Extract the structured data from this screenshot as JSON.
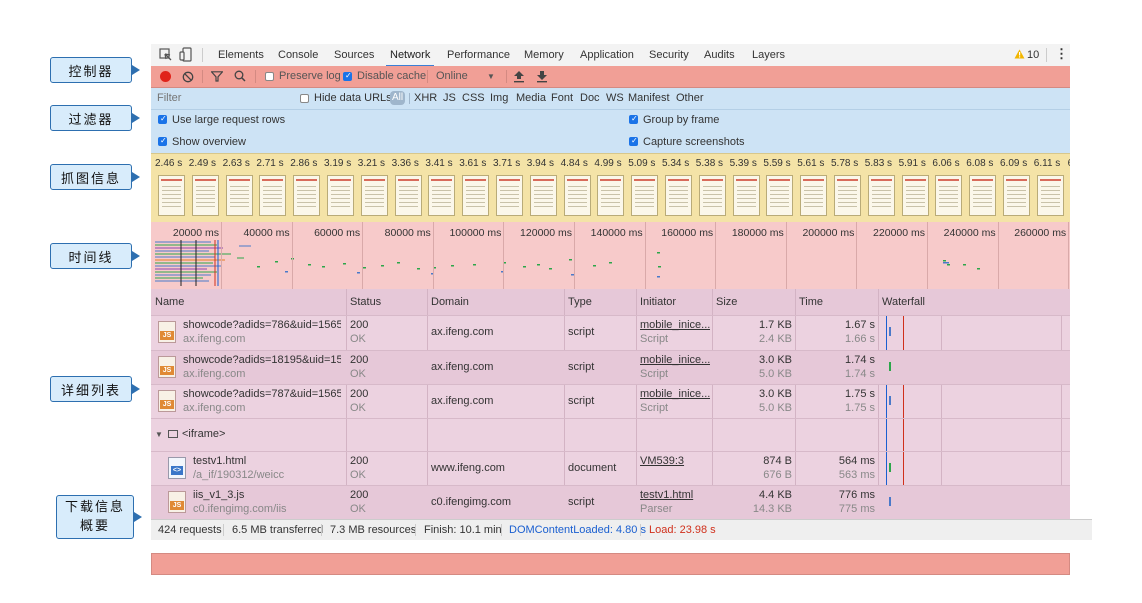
{
  "callouts": {
    "control": "控制器",
    "filter": "过滤器",
    "screenshots": "抓图信息",
    "timeline": "时间线",
    "detail": "详细列表",
    "summary_line1": "下载信息",
    "summary_line2": "概要"
  },
  "tabs": [
    "Elements",
    "Console",
    "Sources",
    "Network",
    "Performance",
    "Memory",
    "Application",
    "Security",
    "Audits",
    "Layers"
  ],
  "active_tab": "Network",
  "warnings": "10",
  "controls": {
    "preserve_log": "Preserve log",
    "disable_cache": "Disable cache",
    "throttle": "Online"
  },
  "filter": {
    "placeholder": "Filter",
    "hide_data_urls": "Hide data URLs",
    "types": [
      "All",
      "XHR",
      "JS",
      "CSS",
      "Img",
      "Media",
      "Font",
      "Doc",
      "WS",
      "Manifest",
      "Other"
    ],
    "use_large_rows": "Use large request rows",
    "group_by_frame": "Group by frame",
    "show_overview": "Show overview",
    "capture_screenshots": "Capture screenshots"
  },
  "screenshot_times": [
    "2.46 s",
    "2.49 s",
    "2.63 s",
    "2.71 s",
    "2.86 s",
    "3.19 s",
    "3.21 s",
    "3.36 s",
    "3.41 s",
    "3.61 s",
    "3.71 s",
    "3.94 s",
    "4.84 s",
    "4.99 s",
    "5.09 s",
    "5.34 s",
    "5.38 s",
    "5.39 s",
    "5.59 s",
    "5.61 s",
    "5.78 s",
    "5.83 s",
    "5.91 s",
    "6.06 s",
    "6.08 s",
    "6.09 s",
    "6.11 s",
    "6."
  ],
  "timeline_ticks": [
    "20000 ms",
    "40000 ms",
    "60000 ms",
    "80000 ms",
    "100000 ms",
    "120000 ms",
    "140000 ms",
    "160000 ms",
    "180000 ms",
    "200000 ms",
    "220000 ms",
    "240000 ms",
    "260000 ms"
  ],
  "columns": [
    "Name",
    "Status",
    "Domain",
    "Type",
    "Initiator",
    "Size",
    "Time",
    "Waterfall"
  ],
  "rows": [
    {
      "name": "showcode?adids=786&uid=1565...",
      "host": "ax.ifeng.com",
      "status": "200",
      "status_text": "OK",
      "domain": "ax.ifeng.com",
      "type": "script",
      "initiator": "mobile_inice...",
      "initiator_type": "Script",
      "size": "1.7 KB",
      "size2": "2.4 KB",
      "time": "1.67 s",
      "time2": "1.66 s"
    },
    {
      "name": "showcode?adids=18195&uid=15...",
      "host": "ax.ifeng.com",
      "status": "200",
      "status_text": "OK",
      "domain": "ax.ifeng.com",
      "type": "script",
      "initiator": "mobile_inice...",
      "initiator_type": "Script",
      "size": "3.0 KB",
      "size2": "5.0 KB",
      "time": "1.74 s",
      "time2": "1.74 s"
    },
    {
      "name": "showcode?adids=787&uid=1565...",
      "host": "ax.ifeng.com",
      "status": "200",
      "status_text": "OK",
      "domain": "ax.ifeng.com",
      "type": "script",
      "initiator": "mobile_inice...",
      "initiator_type": "Script",
      "size": "3.0 KB",
      "size2": "5.0 KB",
      "time": "1.75 s",
      "time2": "1.75 s"
    }
  ],
  "group_label": "<iframe>",
  "group_rows": [
    {
      "name": "testv1.html",
      "host": "/a_if/190312/weicc",
      "status": "200",
      "status_text": "OK",
      "domain": "www.ifeng.com",
      "type": "document",
      "initiator": "VM539:3",
      "initiator_type": "",
      "size": "874 B",
      "size2": "676 B",
      "time": "564 ms",
      "time2": "563 ms"
    },
    {
      "name": "iis_v1_3.js",
      "host": "c0.ifengimg.com/iis",
      "status": "200",
      "status_text": "OK",
      "domain": "c0.ifengimg.com",
      "type": "script",
      "initiator": "testv1.html",
      "initiator_type": "Parser",
      "size": "4.4 KB",
      "size2": "14.3 KB",
      "time": "776 ms",
      "time2": "775 ms"
    }
  ],
  "status": {
    "requests": "424 requests",
    "transferred": "6.5 MB transferred",
    "resources": "7.3 MB resources",
    "finish": "Finish: 10.1 min",
    "dom_loaded": "DOMContentLoaded: 4.80 s",
    "load": "Load: 23.98 s"
  },
  "colors": {
    "control_bg": "#f19f96",
    "filter_bg": "#cde3f5",
    "screenshots_bg": "#f4e3a7",
    "timeline_bg": "#f7caca",
    "table_bg": "#ecd2e0",
    "dom_loaded": "#1a5fd0",
    "load": "#d0301c"
  }
}
